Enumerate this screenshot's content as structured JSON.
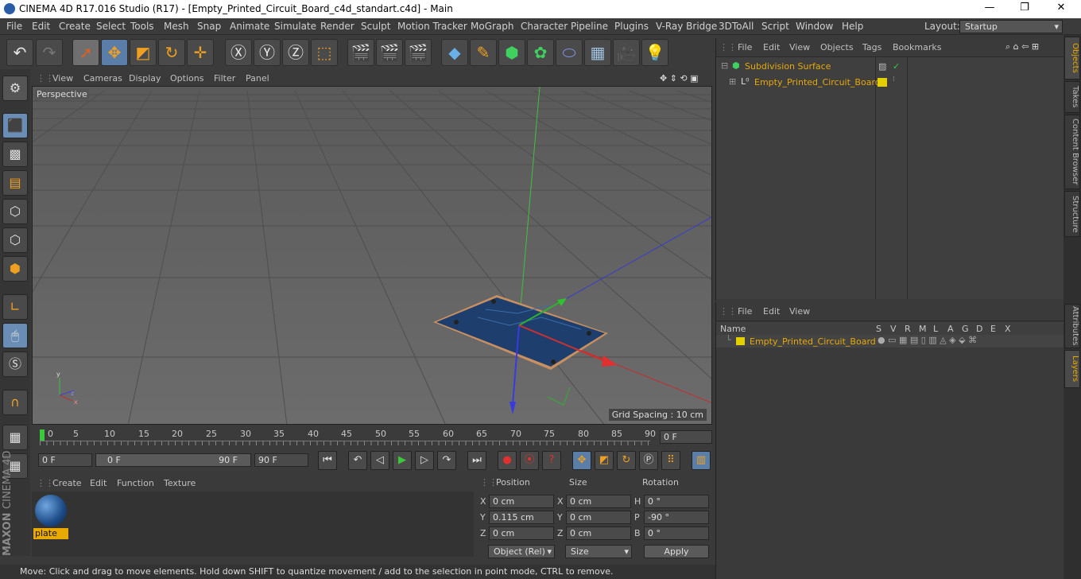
{
  "app": {
    "window_title": "CINEMA 4D R17.016 Studio (R17) - [Empty_Printed_Circuit_Board_c4d_standart.c4d] - Main",
    "minimize": "—",
    "maximize": "❐",
    "close": "✕"
  },
  "menu": [
    "File",
    "Edit",
    "Create",
    "Select",
    "Tools",
    "Mesh",
    "Snap",
    "Animate",
    "Simulate",
    "Render",
    "Sculpt",
    "Motion Tracker",
    "MoGraph",
    "Character",
    "Pipeline",
    "Plugins",
    "V-Ray Bridge",
    "3DToAll",
    "Script",
    "Window",
    "Help"
  ],
  "layout": {
    "label": "Layout:",
    "value": "Startup"
  },
  "viewport": {
    "menu": [
      "View",
      "Cameras",
      "Display",
      "Options",
      "Filter",
      "Panel"
    ],
    "camera_label": "Perspective",
    "grid_spacing": "Grid Spacing : 10 cm"
  },
  "timeline": {
    "ticks": [
      "0",
      "5",
      "10",
      "15",
      "20",
      "25",
      "30",
      "35",
      "40",
      "45",
      "50",
      "55",
      "60",
      "65",
      "70",
      "75",
      "80",
      "85",
      "90"
    ],
    "current_frame": "0 F",
    "start_frame": "0 F",
    "range_start": "0 F",
    "range_end": "90 F",
    "end_frame": "90 F"
  },
  "material": {
    "menu": [
      "Create",
      "Edit",
      "Function",
      "Texture"
    ],
    "name": "plate"
  },
  "coords": {
    "headers": {
      "position": "Position",
      "size": "Size",
      "rotation": "Rotation"
    },
    "rows": [
      {
        "axis": "X",
        "pos": "0 cm",
        "size_axis": "X",
        "size": "0 cm",
        "rot_axis": "H",
        "rot": "0 °"
      },
      {
        "axis": "Y",
        "pos": "0.115 cm",
        "size_axis": "Y",
        "size": "0 cm",
        "rot_axis": "P",
        "rot": "-90 °"
      },
      {
        "axis": "Z",
        "pos": "0 cm",
        "size_axis": "Z",
        "size": "0 cm",
        "rot_axis": "B",
        "rot": "0 °"
      }
    ],
    "mode_select": "Object (Rel)",
    "size_select": "Size",
    "apply": "Apply"
  },
  "objects": {
    "menu": [
      "File",
      "Edit",
      "View",
      "Objects",
      "Tags",
      "Bookmarks"
    ],
    "items": [
      "Subdivision Surface",
      "Empty_Printed_Circuit_Board"
    ]
  },
  "layers": {
    "menu": [
      "File",
      "Edit",
      "View"
    ],
    "columns": [
      "Name",
      "S",
      "V",
      "R",
      "M",
      "L",
      "A",
      "G",
      "D",
      "E",
      "X"
    ],
    "items": [
      "Empty_Printed_Circuit_Board"
    ]
  },
  "side_tabs": [
    "Objects",
    "Takes",
    "Content Browser",
    "Structure",
    "Attributes",
    "Layers"
  ],
  "branding": {
    "maxon": "MAXON",
    "cinema": "CINEMA 4D"
  },
  "status": "Move: Click and drag to move elements. Hold down SHIFT to quantize movement / add to the selection in point mode, CTRL to remove.",
  "colors": {
    "accent": "#e8a900",
    "selected_tool": "#6a8db6",
    "layer_yellow": "#e4d000"
  }
}
